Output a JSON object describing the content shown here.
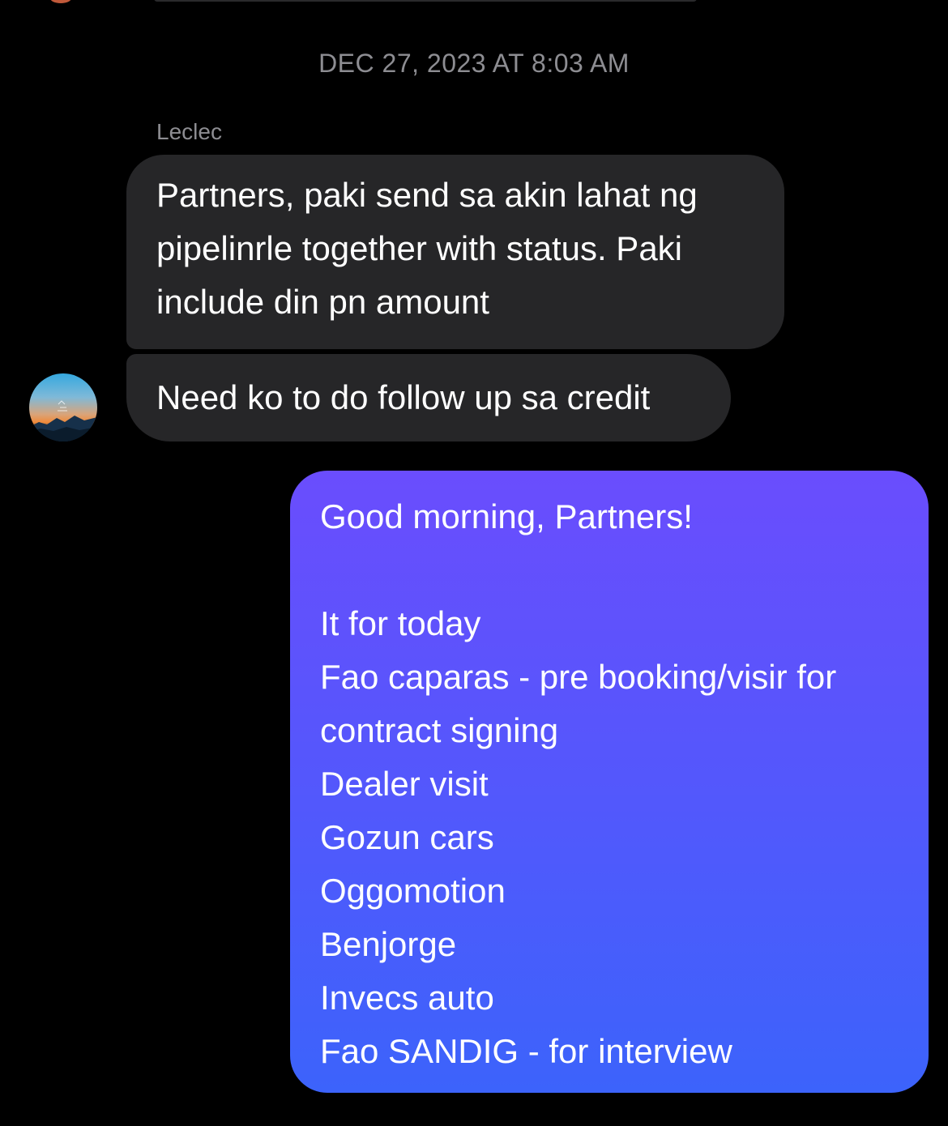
{
  "conversation": {
    "timestamp": "DEC 27, 2023 AT 8:03 AM",
    "sender_name": "Leclec",
    "incoming_messages": [
      {
        "lines": [
          "Partners, paki send sa akin lahat ng",
          "pipelinrle together with status. Paki",
          "include din pn amount"
        ]
      },
      {
        "lines": [
          "Need ko to do follow up sa credit"
        ]
      }
    ],
    "outgoing_message": {
      "lines": [
        "Good morning, Partners!",
        "",
        "It for today",
        "Fao caparas - pre booking/visir for",
        "contract signing",
        "Dealer visit",
        "Gozun cars",
        "Oggomotion",
        "Benjorge",
        "Invecs auto",
        "Fao SANDIG - for interview"
      ]
    }
  },
  "avatar": {
    "icon": "sunset-mountain-avatar"
  },
  "colors": {
    "background": "#000000",
    "incoming_bubble": "#262628",
    "outgoing_gradient_top": "#6a4dfd",
    "outgoing_gradient_bottom": "#3c63fb",
    "meta_text": "#8d8d92"
  }
}
